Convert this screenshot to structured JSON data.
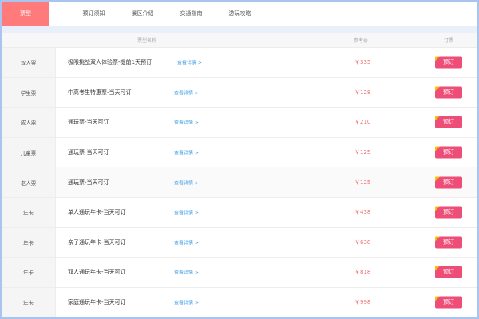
{
  "tabs": [
    {
      "label": "票型",
      "active": true
    },
    {
      "label": "预订须知",
      "active": false
    },
    {
      "label": "景区介绍",
      "active": false
    },
    {
      "label": "交通指南",
      "active": false
    },
    {
      "label": "游玩攻略",
      "active": false
    }
  ],
  "table": {
    "headers": {
      "name": "票型名称",
      "price": "参考价",
      "order": "订票"
    },
    "rows": [
      {
        "type": "双人票",
        "name": "极限挑战双人体验票-提前1天预订",
        "detail": "查看详情 >",
        "price": "￥335",
        "order": "预订"
      },
      {
        "type": "学生票",
        "name": "中高考生特惠票-当天可订",
        "detail": "查看详情 >",
        "price": "￥128",
        "order": "预订"
      },
      {
        "type": "成人票",
        "name": "通玩票-当天可订",
        "detail": "查看详情 >",
        "price": "￥210",
        "order": "预订"
      },
      {
        "type": "儿童票",
        "name": "通玩票-当天可订",
        "detail": "查看详情 >",
        "price": "￥125",
        "order": "预订"
      },
      {
        "type": "老人票",
        "name": "通玩票-当天可订",
        "detail": "查看详情 >",
        "price": "￥125",
        "order": "预订"
      },
      {
        "type": "年卡",
        "name": "单人通玩年卡-当天可订",
        "detail": "查看详情 >",
        "price": "￥438",
        "order": "预订"
      },
      {
        "type": "年卡",
        "name": "亲子通玩年卡-当天可订",
        "detail": "查看详情 >",
        "price": "￥638",
        "order": "预订"
      },
      {
        "type": "年卡",
        "name": "双人通玩年卡-当天可订",
        "detail": "查看详情 >",
        "price": "￥818",
        "order": "预订"
      },
      {
        "type": "年卡",
        "name": "家庭通玩年卡-当天可订",
        "detail": "查看详情 >",
        "price": "￥998",
        "order": "预订"
      }
    ]
  },
  "colors": {
    "active_tab": "#ff7a7a",
    "price": "#f26b6b",
    "detail_link": "#4aa3e6",
    "order_button": "#ee4d77",
    "order_corner": "#f5c400",
    "frame_border": "#a9c4ef"
  }
}
